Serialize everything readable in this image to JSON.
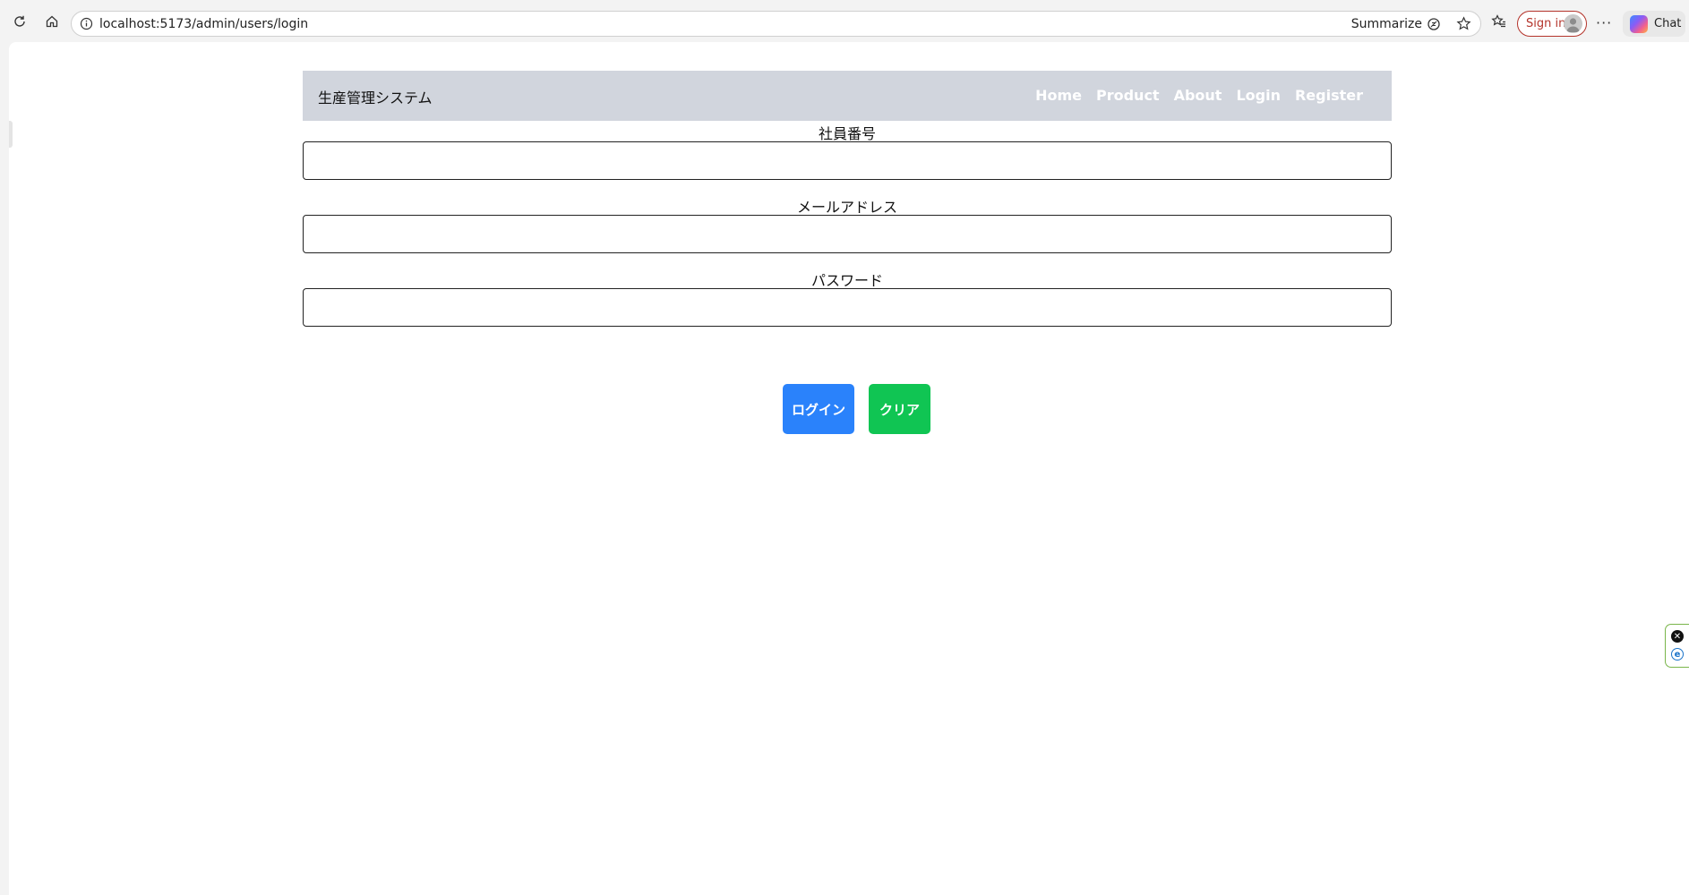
{
  "browser": {
    "url": "localhost:5173/admin/users/login",
    "summarize_label": "Summarize",
    "signin_label": "Sign in",
    "chat_label": "Chat",
    "more_label": "···"
  },
  "navbar": {
    "brand": "生産管理システム",
    "links": [
      "Home",
      "Product",
      "About",
      "Login",
      "Register"
    ]
  },
  "form": {
    "employee_id_label": "社員番号",
    "employee_id_value": "",
    "email_label": "メールアドレス",
    "email_value": "",
    "password_label": "パスワード",
    "password_value": "",
    "login_button": "ログイン",
    "clear_button": "クリア"
  },
  "colors": {
    "navbar_bg": "#d1d5dd",
    "login_button": "#2a82fb",
    "clear_button": "#10c553",
    "signin_border": "#b4342b"
  }
}
